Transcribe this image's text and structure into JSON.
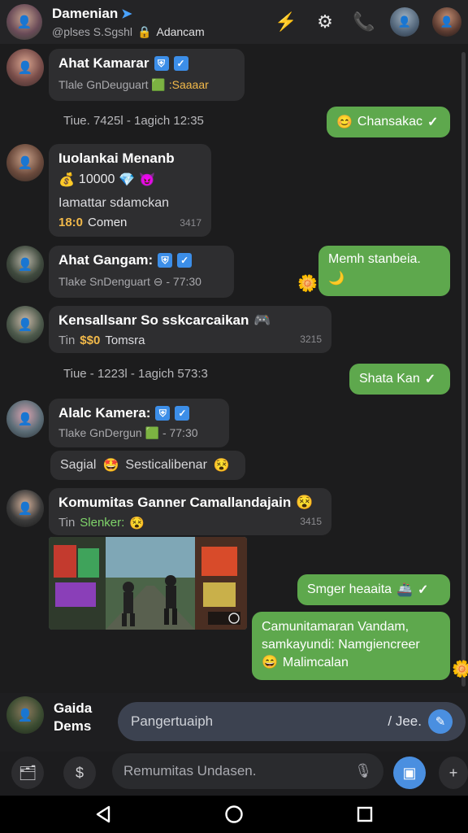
{
  "header": {
    "title": "Damenian",
    "subtitle_handle": "@plses S.Sgshl",
    "subtitle_name": "Adancam",
    "icons": [
      "bolt-icon",
      "gear-icon",
      "phone-icon"
    ]
  },
  "messages": [
    {
      "sender": "Ahat Kamarar",
      "sub": "Tlale GnDeuguart",
      "sub_tag": ":Saaaar"
    },
    {
      "text": "Chansakac"
    },
    {
      "date": "Tiue. 7425l - 1agich 12:35"
    },
    {
      "sender": "Iuolankai Menanb",
      "amount": "10000",
      "text": "Iamattar sdamckan",
      "count": "18:0",
      "tag": "Comen",
      "time": "3417"
    },
    {
      "sender": "Ahat Gangam:",
      "sub": "Tlake SnDenguart ⊖ - 77:30"
    },
    {
      "text": "Memh stanbeia."
    },
    {
      "sender": "Kensallsanr So sskcarcaikan",
      "sub": "Tin",
      "tag": "Tomsra",
      "amount": "$$0",
      "time": "3215"
    },
    {
      "date": "Tiue - 1223l - 1agich 573:3"
    },
    {
      "text": "Shata Kan"
    },
    {
      "sender": "Alalc Kamera:",
      "sub": "Tlake GnDergun",
      "time": "- 77:30"
    },
    {
      "text": "Sagial",
      "tag": "Sesticalibenar"
    },
    {
      "sender": "Komumitas Ganner Camallandajain",
      "sub": "Tin",
      "tag": "Slenker:",
      "time": "3415"
    },
    {
      "text": "Smger heaaita"
    },
    {
      "text": "Camunitamaran Vandam, samkayundi: Namgiencreer",
      "tag": "Malimcalan"
    }
  ],
  "input": {
    "label_line1": "Gaida",
    "label_line2": "Dems",
    "placeholder": "Pangertuaiph",
    "right_text": "/ Jee."
  },
  "toolbar": {
    "placeholder": "Remumitas Undasen."
  },
  "colors": {
    "outgoing": "#5ea84d",
    "incoming": "#2e2e30",
    "accent": "#4a8fe0",
    "background": "#1b1b1c"
  }
}
